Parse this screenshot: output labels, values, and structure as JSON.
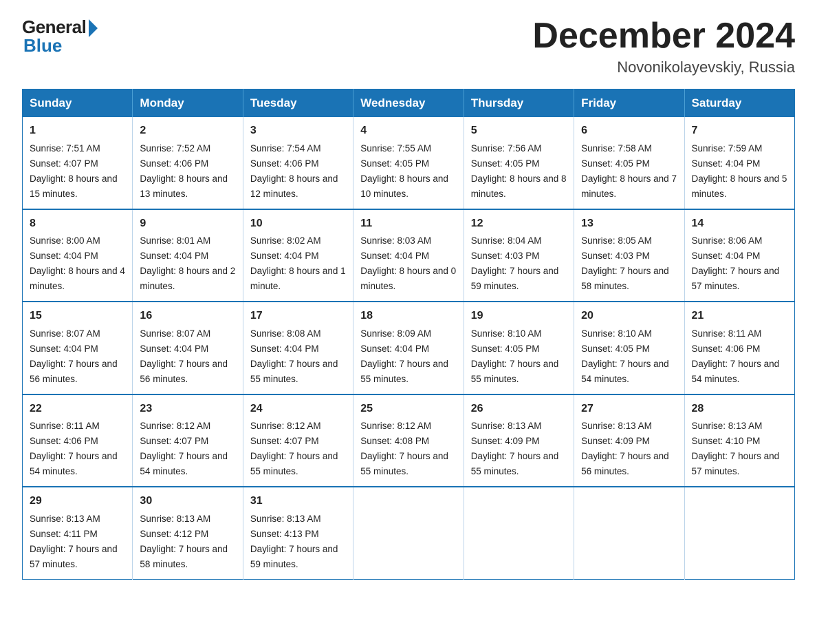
{
  "header": {
    "logo_general": "General",
    "logo_blue": "Blue",
    "month_title": "December 2024",
    "location": "Novonikolayevskiy, Russia"
  },
  "weekdays": [
    "Sunday",
    "Monday",
    "Tuesday",
    "Wednesday",
    "Thursday",
    "Friday",
    "Saturday"
  ],
  "weeks": [
    [
      {
        "day": "1",
        "sunrise": "7:51 AM",
        "sunset": "4:07 PM",
        "daylight": "8 hours and 15 minutes."
      },
      {
        "day": "2",
        "sunrise": "7:52 AM",
        "sunset": "4:06 PM",
        "daylight": "8 hours and 13 minutes."
      },
      {
        "day": "3",
        "sunrise": "7:54 AM",
        "sunset": "4:06 PM",
        "daylight": "8 hours and 12 minutes."
      },
      {
        "day": "4",
        "sunrise": "7:55 AM",
        "sunset": "4:05 PM",
        "daylight": "8 hours and 10 minutes."
      },
      {
        "day": "5",
        "sunrise": "7:56 AM",
        "sunset": "4:05 PM",
        "daylight": "8 hours and 8 minutes."
      },
      {
        "day": "6",
        "sunrise": "7:58 AM",
        "sunset": "4:05 PM",
        "daylight": "8 hours and 7 minutes."
      },
      {
        "day": "7",
        "sunrise": "7:59 AM",
        "sunset": "4:04 PM",
        "daylight": "8 hours and 5 minutes."
      }
    ],
    [
      {
        "day": "8",
        "sunrise": "8:00 AM",
        "sunset": "4:04 PM",
        "daylight": "8 hours and 4 minutes."
      },
      {
        "day": "9",
        "sunrise": "8:01 AM",
        "sunset": "4:04 PM",
        "daylight": "8 hours and 2 minutes."
      },
      {
        "day": "10",
        "sunrise": "8:02 AM",
        "sunset": "4:04 PM",
        "daylight": "8 hours and 1 minute."
      },
      {
        "day": "11",
        "sunrise": "8:03 AM",
        "sunset": "4:04 PM",
        "daylight": "8 hours and 0 minutes."
      },
      {
        "day": "12",
        "sunrise": "8:04 AM",
        "sunset": "4:03 PM",
        "daylight": "7 hours and 59 minutes."
      },
      {
        "day": "13",
        "sunrise": "8:05 AM",
        "sunset": "4:03 PM",
        "daylight": "7 hours and 58 minutes."
      },
      {
        "day": "14",
        "sunrise": "8:06 AM",
        "sunset": "4:04 PM",
        "daylight": "7 hours and 57 minutes."
      }
    ],
    [
      {
        "day": "15",
        "sunrise": "8:07 AM",
        "sunset": "4:04 PM",
        "daylight": "7 hours and 56 minutes."
      },
      {
        "day": "16",
        "sunrise": "8:07 AM",
        "sunset": "4:04 PM",
        "daylight": "7 hours and 56 minutes."
      },
      {
        "day": "17",
        "sunrise": "8:08 AM",
        "sunset": "4:04 PM",
        "daylight": "7 hours and 55 minutes."
      },
      {
        "day": "18",
        "sunrise": "8:09 AM",
        "sunset": "4:04 PM",
        "daylight": "7 hours and 55 minutes."
      },
      {
        "day": "19",
        "sunrise": "8:10 AM",
        "sunset": "4:05 PM",
        "daylight": "7 hours and 55 minutes."
      },
      {
        "day": "20",
        "sunrise": "8:10 AM",
        "sunset": "4:05 PM",
        "daylight": "7 hours and 54 minutes."
      },
      {
        "day": "21",
        "sunrise": "8:11 AM",
        "sunset": "4:06 PM",
        "daylight": "7 hours and 54 minutes."
      }
    ],
    [
      {
        "day": "22",
        "sunrise": "8:11 AM",
        "sunset": "4:06 PM",
        "daylight": "7 hours and 54 minutes."
      },
      {
        "day": "23",
        "sunrise": "8:12 AM",
        "sunset": "4:07 PM",
        "daylight": "7 hours and 54 minutes."
      },
      {
        "day": "24",
        "sunrise": "8:12 AM",
        "sunset": "4:07 PM",
        "daylight": "7 hours and 55 minutes."
      },
      {
        "day": "25",
        "sunrise": "8:12 AM",
        "sunset": "4:08 PM",
        "daylight": "7 hours and 55 minutes."
      },
      {
        "day": "26",
        "sunrise": "8:13 AM",
        "sunset": "4:09 PM",
        "daylight": "7 hours and 55 minutes."
      },
      {
        "day": "27",
        "sunrise": "8:13 AM",
        "sunset": "4:09 PM",
        "daylight": "7 hours and 56 minutes."
      },
      {
        "day": "28",
        "sunrise": "8:13 AM",
        "sunset": "4:10 PM",
        "daylight": "7 hours and 57 minutes."
      }
    ],
    [
      {
        "day": "29",
        "sunrise": "8:13 AM",
        "sunset": "4:11 PM",
        "daylight": "7 hours and 57 minutes."
      },
      {
        "day": "30",
        "sunrise": "8:13 AM",
        "sunset": "4:12 PM",
        "daylight": "7 hours and 58 minutes."
      },
      {
        "day": "31",
        "sunrise": "8:13 AM",
        "sunset": "4:13 PM",
        "daylight": "7 hours and 59 minutes."
      },
      null,
      null,
      null,
      null
    ]
  ]
}
